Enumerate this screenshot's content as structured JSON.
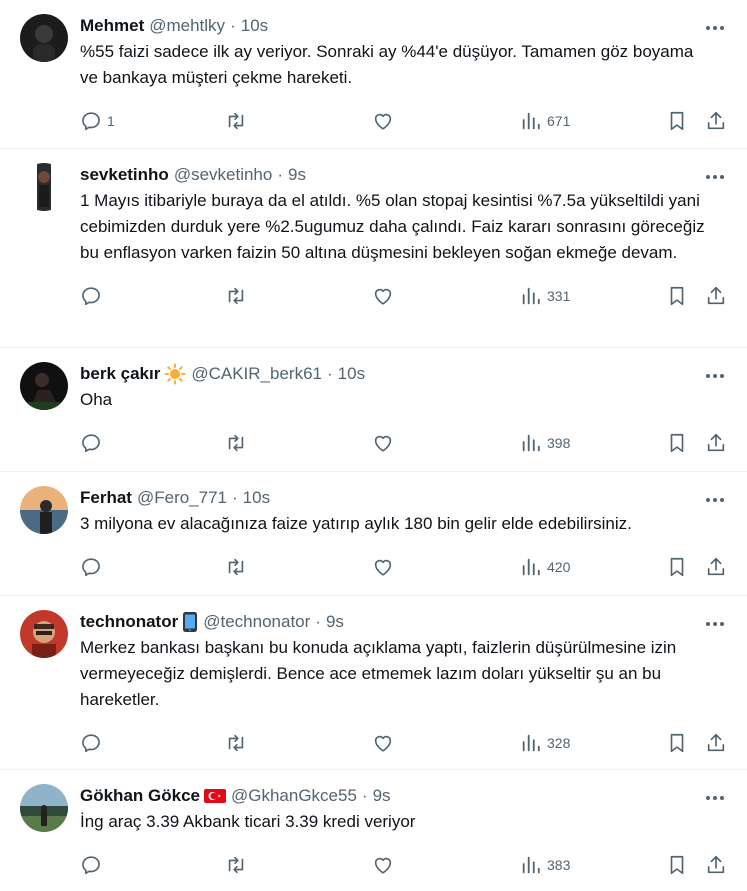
{
  "tweets": [
    {
      "name": "Mehmet",
      "handle": "@mehtlky",
      "sep": "·",
      "time": "10s",
      "badge": "",
      "text": "%55 faizi sadece ilk ay veriyor. Sonraki ay %44'e düşüyor. Tamamen göz boyama ve bankaya müşteri çekme hareketi.",
      "replies": "1",
      "views": "671"
    },
    {
      "name": "sevketinho",
      "handle": "@sevketinho",
      "sep": "·",
      "time": "9s",
      "badge": "",
      "text": "1 Mayıs itibariyle buraya da el atıldı. %5 olan stopaj kesintisi %7.5a yükseltildi yani cebimizden durduk yere %2.5ugumuz daha çalındı. Faiz kararı sonrasını göreceğiz bu enflasyon varken faizin 50 altına düşmesini bekleyen soğan ekmeğe devam.",
      "replies": "",
      "views": "331"
    },
    {
      "name": "berk çakır",
      "handle": "@CAKIR_berk61",
      "sep": "·",
      "time": "10s",
      "badge": "sun",
      "text": "Oha",
      "replies": "",
      "views": "398"
    },
    {
      "name": "Ferhat",
      "handle": "@Fero_771",
      "sep": "·",
      "time": "10s",
      "badge": "",
      "text": "3 milyona ev alacağınıza faize yatırıp aylık 180 bin gelir elde edebilirsiniz.",
      "replies": "",
      "views": "420"
    },
    {
      "name": "technonator",
      "handle": "@technonator",
      "sep": "·",
      "time": "9s",
      "badge": "phone",
      "text": "Merkez bankası başkanı bu konuda açıklama yaptı, faizlerin düşürülmesine izin vermeyeceğiz demişlerdi. Bence ace etmemek lazım doları yükseltir şu an bu hareketler.",
      "replies": "",
      "views": "328"
    },
    {
      "name": "Gökhan Gökce",
      "handle": "@GkhanGkce55",
      "sep": "·",
      "time": "9s",
      "badge": "flag-tr",
      "text": "İng araç 3.39 Akbank ticari 3.39 kredi veriyor",
      "replies": "",
      "views": "383"
    }
  ],
  "icons": {
    "more": "more-icon",
    "reply": "reply-icon",
    "retweet": "retweet-icon",
    "like": "heart-icon",
    "views": "views-icon",
    "bookmark": "bookmark-icon",
    "share": "share-icon"
  },
  "colors": {
    "text": "#0f1419",
    "secondary": "#536471",
    "divider": "#eff3f4"
  }
}
